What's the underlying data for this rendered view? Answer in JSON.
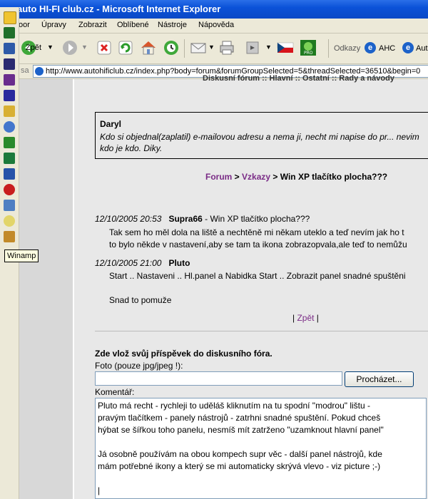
{
  "window": {
    "title": "auto HI-FI club.cz - Microsoft Internet Explorer"
  },
  "menu": [
    "oor",
    "Úpravy",
    "Zobrazit",
    "Oblíbené",
    "Nástroje",
    "Nápověda"
  ],
  "toolbar": {
    "back_label": "Zpět",
    "links_label": "Odkazy",
    "link1": "AHC",
    "link2": "Aut"
  },
  "address": {
    "label": "sa",
    "url": "http://www.autohificlub.cz/index.php?body=forum&forumGroupSelected=5&threadSelected=36510&begin=0"
  },
  "quicklaunch": {
    "tooltip": "Winamp"
  },
  "header_strip": "Diskusní fórum :: Hlavní :: Ostatní :: Rady a návody",
  "quote": {
    "author": "Daryl",
    "text": "Kdo si objednal(zaplatil) e-mailovou adresu a nema ji, necht mi napise do pr... nevim kdo je kdo. Diky."
  },
  "breadcrumb": {
    "forum": "Forum",
    "sep1": " > ",
    "vzkazy": "Vzkazy",
    "sep2": " > ",
    "thread": "Win XP tlačítko plocha???"
  },
  "posts": [
    {
      "date": "12/10/2005 20:53",
      "author": "Supra66",
      "subject": " - Win XP tlačítko plocha???",
      "lines": [
        "Tak sem ho měl dola na liště a nechtěně mi někam uteklo a teď nevím jak ho t",
        "to bylo někde v nastavení,aby se tam ta ikona zobrazopvala,ale teď to nemůžu"
      ]
    },
    {
      "date": "12/10/2005 21:00",
      "author": "Pluto",
      "subject": "",
      "lines": [
        "Start .. Nastaveni .. Hl.panel a Nabidka Start .. Zobrazit panel snadné spuštěni",
        "",
        "Snad to pomuže"
      ]
    }
  ],
  "back_link": {
    "left": "| ",
    "label": "Zpět",
    "right": " |"
  },
  "form": {
    "title": "Zde vlož svůj příspěvek do diskusního fóra.",
    "photo_label": "Foto (pouze jpg/jpeg !):",
    "browse_label": "Procházet...",
    "comment_label": "Komentář:",
    "comment_text": "Pluto má recht - rychleji to uděláš kliknutím na tu spodní \"modrou\" lištu -\npravým tlačítkem - panely nástrojů - zatrhni snadné spuštění. Pokud chceš\nhýbat se šířkou toho panelu, nesmíš mít zatrženo \"uzamknout hlavní panel\"\n\nJá osobně používám na obou kompech supr věc - další panel nástrojů, kde\nmám potřebné ikony a který se mi automaticky skrývá vlevo - viz picture ;-)\n\n|"
  }
}
